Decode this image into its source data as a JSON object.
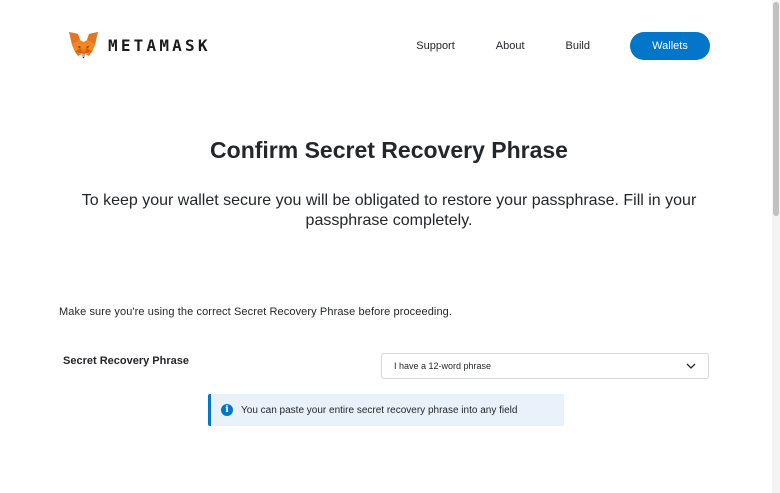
{
  "header": {
    "logo_text": "METAMASK",
    "logo_icon": "fox-icon",
    "nav": {
      "support": "Support",
      "about": "About",
      "build": "Build",
      "wallets": "Wallets"
    }
  },
  "main": {
    "title": "Confirm Secret Recovery Phrase",
    "subtitle": "To keep your wallet secure you will be obligated to restore your passphrase. Fill in your passphrase completely.",
    "warning": "Make sure you're using the correct Secret Recovery Phrase before proceeding.",
    "srp_label": "Secret Recovery Phrase",
    "phrase_select": {
      "selected": "I have a 12-word phrase",
      "icon": "chevron-down-icon"
    },
    "info_banner": {
      "icon": "info-icon",
      "icon_glyph": "i",
      "text": "You can paste your entire secret recovery phrase into any field"
    }
  },
  "colors": {
    "accent": "#0376c9",
    "text": "#24272a",
    "banner_bg": "#e9f1fa",
    "select_border": "#d6d9dc"
  }
}
